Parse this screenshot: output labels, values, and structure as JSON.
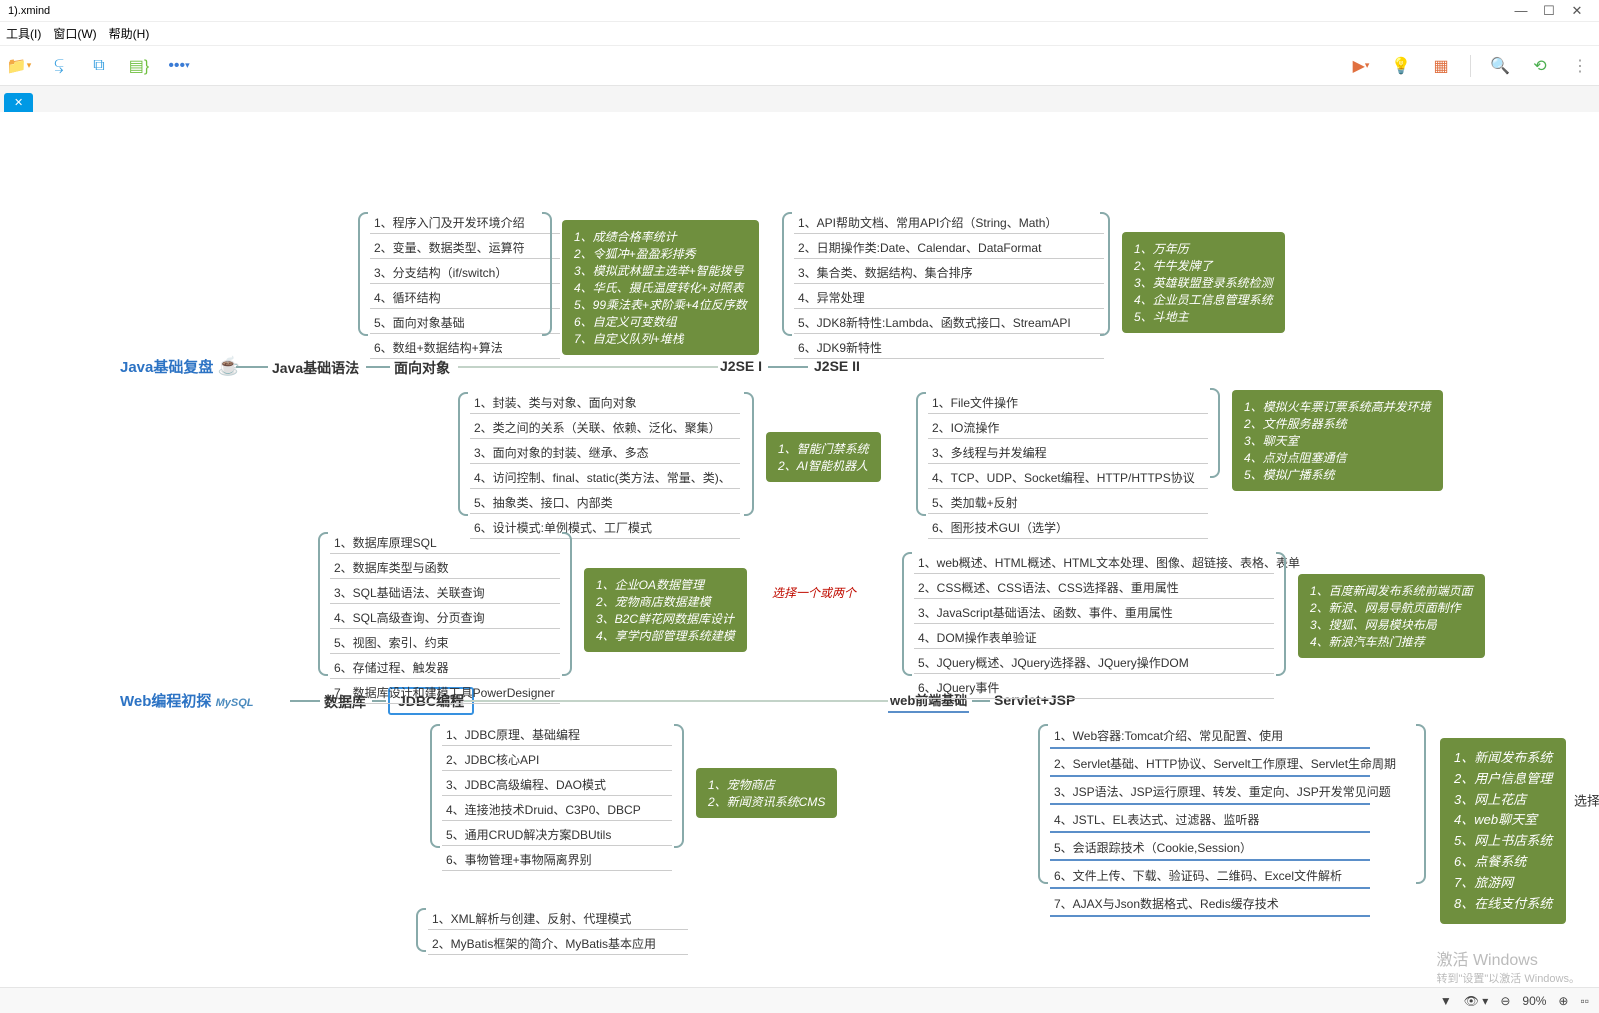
{
  "window": {
    "title": "1).xmind"
  },
  "menu": {
    "tool": "工具(I)",
    "window": "窗口(W)",
    "help": "帮助(H)"
  },
  "toolbar_right": {
    "present": "present-icon",
    "idea": "idea-icon",
    "chart": "chart-icon",
    "zoom": "zoom-icon",
    "share": "share-icon",
    "more": "more-icon"
  },
  "root1": "Java基础复盘",
  "root2": "Web编程初探",
  "t_java_basic": "Java基础语法",
  "t_oop": "面向对象",
  "t_j2se1": "J2SE I",
  "t_j2se2": "J2SE II",
  "t_db": "数据库",
  "t_jdbc": "JDBC编程",
  "t_webfe": "web前端基础",
  "t_servlet": "Servlet+JSP",
  "java_basic": [
    "1、程序入门及开发环境介绍",
    "2、变量、数据类型、运算符",
    "3、分支结构（if/switch）",
    "4、循环结构",
    "5、面向对象基础",
    "6、数组+数据结构+算法"
  ],
  "note1": [
    "1、成绩合格率统计",
    "2、令狐冲+盈盈彩排秀",
    "3、模拟武林盟主选举+智能拨号",
    "4、华氏、摄氏温度转化+对照表",
    "5、99乘法表+求阶乘+4位反序数",
    "6、自定义可变数组",
    "7、自定义队列+堆栈"
  ],
  "j2se1": [
    "1、API帮助文档、常用API介绍（String、Math）",
    "2、日期操作类:Date、Calendar、DataFormat",
    "3、集合类、数据结构、集合排序",
    "4、异常处理",
    "5、JDK8新特性:Lambda、函数式接口、StreamAPI",
    "6、JDK9新特性"
  ],
  "note2": [
    "1、万年历",
    "2、牛牛发牌了",
    "3、英雄联盟登录系统检测",
    "4、企业员工信息管理系统",
    "5、斗地主"
  ],
  "oop": [
    "1、封装、类与对象、面向对象",
    "2、类之间的关系（关联、依赖、泛化、聚集）",
    "3、面向对象的封装、继承、多态",
    "4、访问控制、final、static(类方法、常量、类)、",
    "5、抽象类、接口、内部类",
    "6、设计模式:单例模式、工厂模式"
  ],
  "note3": [
    "1、智能门禁系统",
    "2、AI智能机器人"
  ],
  "j2se2": [
    "1、File文件操作",
    "2、IO流操作",
    "3、多线程与并发编程",
    "4、TCP、UDP、Socket编程、HTTP/HTTPS协议",
    "5、类加载+反射",
    "6、图形技术GUI（选学）"
  ],
  "note4": [
    "1、模拟火车票订票系统高并发环境",
    "2、文件服务器系统",
    "3、聊天室",
    "4、点对点阻塞通信",
    "5、模拟广播系统"
  ],
  "db": [
    "1、数据库原理SQL",
    "2、数据库类型与函数",
    "3、SQL基础语法、关联查询",
    "4、SQL高级查询、分页查询",
    "5、视图、索引、约束",
    "6、存储过程、触发器",
    "7、数据库设计和建模工具PowerDesigner"
  ],
  "note5": [
    "1、企业OA数据管理",
    "2、宠物商店数据建模",
    "3、B2C鲜花网数据库设计",
    "4、享学内部管理系统建模"
  ],
  "sel": "选择一个或两个",
  "webfe": [
    "1、web概述、HTML概述、HTML文本处理、图像、超链接、表格、表单",
    "2、CSS概述、CSS语法、CSS选择器、重用属性",
    "3、JavaScript基础语法、函数、事件、重用属性",
    "4、DOM操作表单验证",
    "5、JQuery概述、JQuery选择器、JQuery操作DOM",
    "6、JQuery事件"
  ],
  "note6": [
    "1、百度新闻发布系统前端页面",
    "2、新浪、网易导航页面制作",
    "3、搜狐、网易模块布局",
    "4、新浪汽车热门推荐"
  ],
  "jdbc": [
    "1、JDBC原理、基础编程",
    "2、JDBC核心API",
    "3、JDBC高级编程、DAO模式",
    "4、连接池技术Druid、C3P0、DBCP",
    "5、通用CRUD解决方案DBUtils",
    "6、事物管理+事物隔离界别"
  ],
  "note7": [
    "1、宠物商店",
    "2、新闻资讯系统CMS"
  ],
  "servlet": [
    "1、Web容器:Tomcat介绍、常见配置、使用",
    "2、Servlet基础、HTTP协议、Servelt工作原理、Servlet生命周期",
    "3、JSP语法、JSP运行原理、转发、重定向、JSP开发常见问题",
    "4、JSTL、EL表达式、过滤器、监听器",
    "5、会话跟踪技术（Cookie,Session）",
    "6、文件上传、下载、验证码、二维码、Excel文件解析",
    "7、AJAX与Json数据格式、Redis缓存技术"
  ],
  "note8": [
    "1、新闻发布系统",
    "2、用户信息管理",
    "3、网上花店",
    "4、web聊天室",
    "5、网上书店系统",
    "6、点餐系统",
    "7、旅游网",
    "8、在线支付系统"
  ],
  "xml": [
    "1、XML解析与创建、反射、代理模式",
    "2、MyBatis框架的简介、MyBatis基本应用"
  ],
  "right_crop": "选择",
  "watermark": {
    "title": "激活 Windows",
    "sub": "转到\"设置\"以激活 Windows。"
  },
  "status": {
    "zoom": "90%"
  }
}
